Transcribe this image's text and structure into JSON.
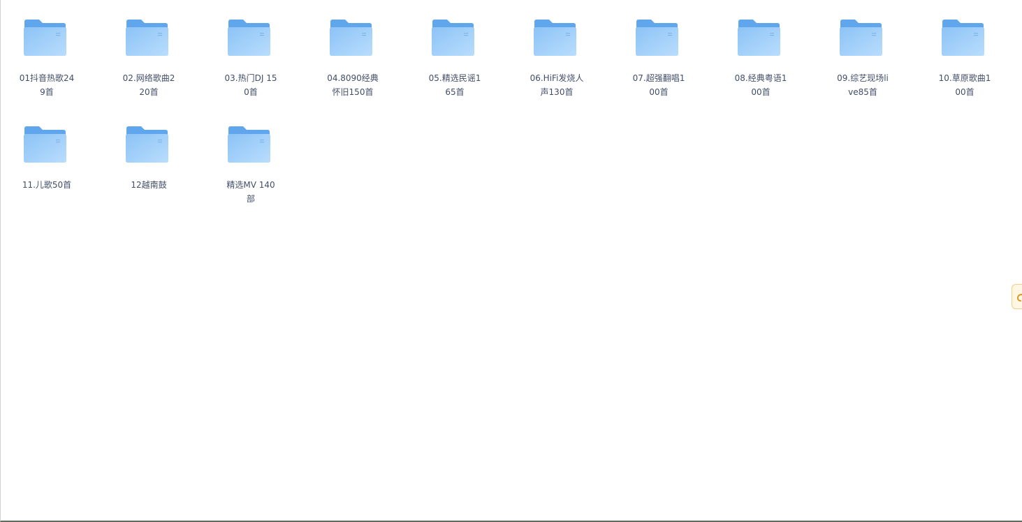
{
  "folders": [
    {
      "name": "01抖音热歌249首",
      "icon": "folder-icon"
    },
    {
      "name": "02.网络歌曲220首",
      "icon": "folder-icon"
    },
    {
      "name": "03.热门DJ 150首",
      "icon": "folder-icon"
    },
    {
      "name": "04.8090经典怀旧150首",
      "icon": "folder-icon"
    },
    {
      "name": "05.精选民谣165首",
      "icon": "folder-icon"
    },
    {
      "name": "06.HiFi发烧人声130首",
      "icon": "folder-icon"
    },
    {
      "name": "07.超强翻唱100首",
      "icon": "folder-icon"
    },
    {
      "name": "08.经典粤语100首",
      "icon": "folder-icon"
    },
    {
      "name": "09.综艺现场live85首",
      "icon": "folder-icon"
    },
    {
      "name": "10.草原歌曲100首",
      "icon": "folder-icon"
    },
    {
      "name": "11.儿歌50首",
      "icon": "folder-icon"
    },
    {
      "name": "12越南鼓",
      "icon": "folder-icon"
    },
    {
      "name": "精选MV 140部",
      "icon": "folder-icon"
    }
  ],
  "side_tab": {
    "icon": "link-icon"
  },
  "colors": {
    "folder_light": "#a9d4fb",
    "folder_dark": "#6aaef0",
    "label_text": "#424e67",
    "side_tab_bg": "#fff7e3",
    "side_tab_border": "#f0cf8a"
  }
}
